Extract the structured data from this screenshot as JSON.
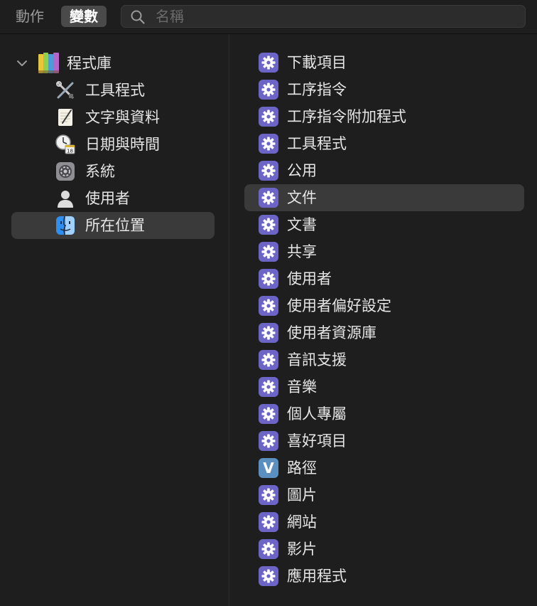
{
  "toolbar": {
    "actions_label": "動作",
    "variables_label": "變數",
    "search_placeholder": "名稱",
    "search_value": ""
  },
  "sidebar": {
    "root": {
      "label": "程式庫",
      "icon": "library-books-icon",
      "expanded": true
    },
    "items": [
      {
        "label": "工具程式",
        "icon": "tools-icon",
        "selected": false
      },
      {
        "label": "文字與資料",
        "icon": "textedit-icon",
        "selected": false
      },
      {
        "label": "日期與時間",
        "icon": "clock-calendar-icon",
        "selected": false
      },
      {
        "label": "系統",
        "icon": "system-preferences-icon",
        "selected": false
      },
      {
        "label": "使用者",
        "icon": "user-icon",
        "selected": false
      },
      {
        "label": "所在位置",
        "icon": "finder-icon",
        "selected": true
      }
    ]
  },
  "content": {
    "items": [
      {
        "label": "下載項目",
        "icon": "gear-icon",
        "selected": false
      },
      {
        "label": "工序指令",
        "icon": "gear-icon",
        "selected": false
      },
      {
        "label": "工序指令附加程式",
        "icon": "gear-icon",
        "selected": false
      },
      {
        "label": "工具程式",
        "icon": "gear-icon",
        "selected": false
      },
      {
        "label": "公用",
        "icon": "gear-icon",
        "selected": false
      },
      {
        "label": "文件",
        "icon": "gear-icon",
        "selected": true
      },
      {
        "label": "文書",
        "icon": "gear-icon",
        "selected": false
      },
      {
        "label": "共享",
        "icon": "gear-icon",
        "selected": false
      },
      {
        "label": "使用者",
        "icon": "gear-icon",
        "selected": false
      },
      {
        "label": "使用者偏好設定",
        "icon": "gear-icon",
        "selected": false
      },
      {
        "label": "使用者資源庫",
        "icon": "gear-icon",
        "selected": false
      },
      {
        "label": "音訊支援",
        "icon": "gear-icon",
        "selected": false
      },
      {
        "label": "音樂",
        "icon": "gear-icon",
        "selected": false
      },
      {
        "label": "個人專屬",
        "icon": "gear-icon",
        "selected": false
      },
      {
        "label": "喜好項目",
        "icon": "gear-icon",
        "selected": false
      },
      {
        "label": "路徑",
        "icon": "variable-v-icon",
        "selected": false
      },
      {
        "label": "圖片",
        "icon": "gear-icon",
        "selected": false
      },
      {
        "label": "網站",
        "icon": "gear-icon",
        "selected": false
      },
      {
        "label": "影片",
        "icon": "gear-icon",
        "selected": false
      },
      {
        "label": "應用程式",
        "icon": "gear-icon",
        "selected": false
      }
    ]
  },
  "colors": {
    "background": "#1e1e1e",
    "selection": "#3a3a3a",
    "gear_tile": "#6c64c6",
    "variable_tile": "#5a8fc0",
    "text": "#e6e6e6"
  }
}
